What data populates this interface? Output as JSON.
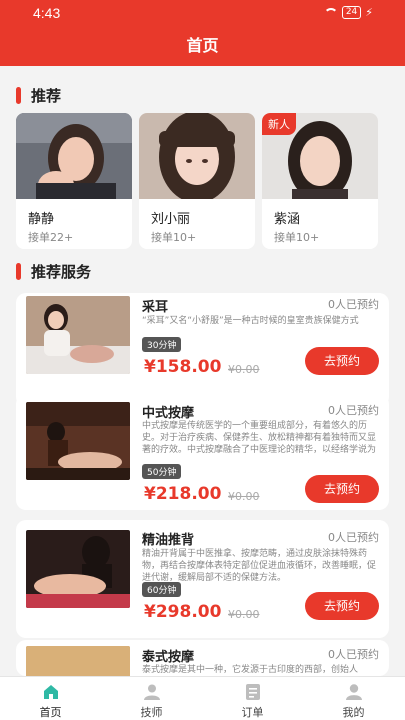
{
  "status": {
    "time": "4:43",
    "battery": "24"
  },
  "header": {
    "title": "首页"
  },
  "recommend": {
    "title": "推荐",
    "therapists": [
      {
        "name": "静静",
        "orders": "接单22+",
        "badge": ""
      },
      {
        "name": "刘小丽",
        "orders": "接单10+",
        "badge": ""
      },
      {
        "name": "紫涵",
        "orders": "接单10+",
        "badge": "新人"
      }
    ]
  },
  "services_section": {
    "title": "推荐服务"
  },
  "services": [
    {
      "name": "采耳",
      "booked": "0人已预约",
      "desc": "“采耳”又名“小舒服”是一种古时候的皇室贵族保健方式",
      "duration": "30分钟",
      "price": "¥158.00",
      "old_price": "¥0.00",
      "button": "去预约"
    },
    {
      "name": "中式按摩",
      "booked": "0人已预约",
      "desc": "中式按摩是传统医学的一个重要组成部分，有着悠久的历史。对于治疗疾病、保健养生、放松精神都有着独特而又显著的疗效。中式按摩融合了中医理论的精华，以经络学说为指导，具有很高的医学价值。",
      "duration": "50分钟",
      "price": "¥218.00",
      "old_price": "¥0.00",
      "button": "去预约"
    },
    {
      "name": "精油推背",
      "booked": "0人已预约",
      "desc": "精油开背属于中医推拿、按摩范畴，通过皮肤涂抹特殊药物，再结合按摩体表特定部位促进血液循环，改善睡眠，促进代谢，缓解局部不适的保健方法。",
      "duration": "60分钟",
      "price": "¥298.00",
      "old_price": "¥0.00",
      "button": "去预约"
    },
    {
      "name": "泰式按摩",
      "booked": "0人已预约",
      "desc": "泰式按摩是其中一种，它发源于古印度的西部，创始人",
      "duration": "",
      "price": "",
      "old_price": "",
      "button": ""
    }
  ],
  "tabs": [
    {
      "label": "首页",
      "icon": "home-icon",
      "active": true
    },
    {
      "label": "技师",
      "icon": "therapist-icon",
      "active": false
    },
    {
      "label": "订单",
      "icon": "orders-icon",
      "active": false
    },
    {
      "label": "我的",
      "icon": "profile-icon",
      "active": false
    }
  ],
  "colors": {
    "brand": "#e8392b",
    "tab_active": "#2fb9a5",
    "tab_inactive": "#bdbdbd"
  }
}
